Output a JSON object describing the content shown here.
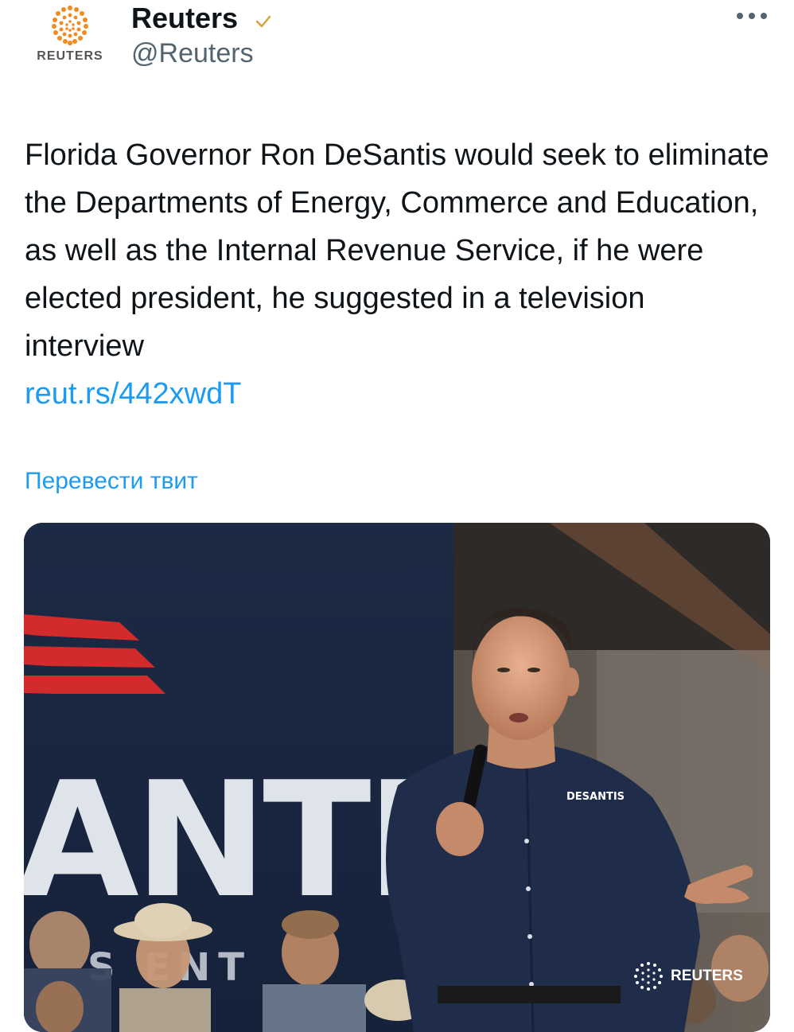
{
  "author": {
    "display_name": "Reuters",
    "handle": "@Reuters",
    "avatar_wordmark": "REUTERS",
    "verified_icon": "checkmark-icon",
    "menu_icon": "more-icon"
  },
  "tweet": {
    "text": "Florida Governor Ron DeSantis would seek to eliminate the Departments of Energy, Commerce and Education, as well as the Internal Revenue Service, if he were elected president, he suggested in a television interview",
    "link": "reut.rs/442xwdT",
    "translate": "Перевести твит"
  },
  "media": {
    "banner_text": "ANTIS",
    "banner_subtext": "S ENT",
    "shirt_text": "DESANTIS",
    "watermark": "REUTERS"
  },
  "colors": {
    "link": "#1d9bf0",
    "text": "#0f1419",
    "secondary": "#536471",
    "reuters_orange": "#f28a1e"
  }
}
